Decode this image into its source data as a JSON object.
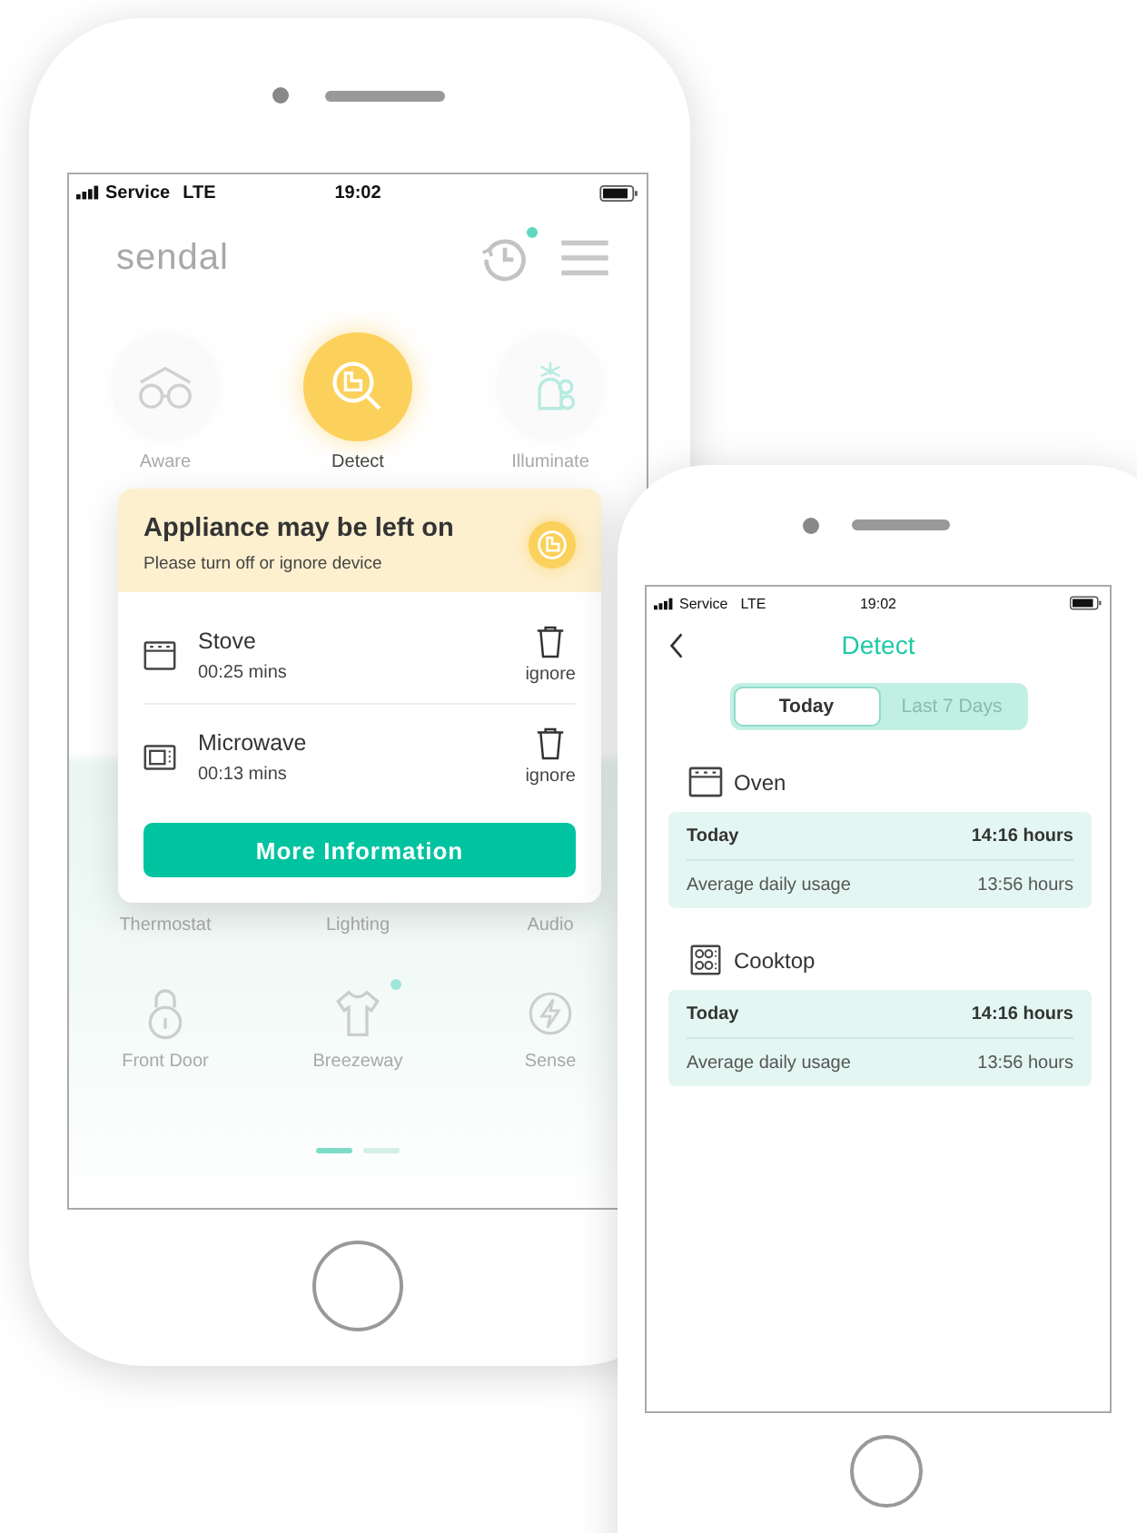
{
  "home_screen": {
    "status_bar": {
      "carrier": "Service",
      "network": "LTE",
      "time": "19:02"
    },
    "logo": "sendal",
    "history_notification": true,
    "tiles": [
      {
        "label": "Aware",
        "kind": "glasses",
        "selected": false
      },
      {
        "label": "Detect",
        "kind": "detect",
        "selected": true
      },
      {
        "label": "Illuminate",
        "kind": "bell",
        "selected": false
      }
    ],
    "covered_tiles": [
      "Thermostat",
      "Lighting",
      "Audio"
    ],
    "lower_tiles": [
      {
        "label": "Front Door",
        "kind": "lock"
      },
      {
        "label": "Breezeway",
        "kind": "shirt",
        "notification": true
      },
      {
        "label": "Sense",
        "kind": "bolt"
      }
    ],
    "page_dots": [
      {
        "selected": true
      },
      {
        "selected": false
      }
    ],
    "alert": {
      "title": "Appliance may be left on",
      "subtitle": "Please turn off or ignore device",
      "devices": [
        {
          "name": "Stove",
          "duration": "00:25 mins",
          "kind": "stove",
          "action": "ignore"
        },
        {
          "name": "Microwave",
          "duration": "00:13 mins",
          "kind": "microwave",
          "action": "ignore"
        }
      ],
      "button": "More Information"
    }
  },
  "detect_screen": {
    "status_bar": {
      "carrier": "Service",
      "network": "LTE",
      "time": "19:02"
    },
    "title": "Detect",
    "segments": [
      {
        "label": "Today",
        "selected": true
      },
      {
        "label": "Last 7 Days",
        "selected": false
      }
    ],
    "appliances": [
      {
        "name": "Oven",
        "kind": "oven",
        "rows": [
          {
            "label": "Today",
            "value": "14:16 hours",
            "emphasis": true
          },
          {
            "label": "Average daily usage",
            "value": "13:56 hours",
            "emphasis": false
          }
        ]
      },
      {
        "name": "Cooktop",
        "kind": "cooktop",
        "rows": [
          {
            "label": "Today",
            "value": "14:16 hours",
            "emphasis": true
          },
          {
            "label": "Average daily usage",
            "value": "13:56 hours",
            "emphasis": false
          }
        ]
      }
    ]
  }
}
